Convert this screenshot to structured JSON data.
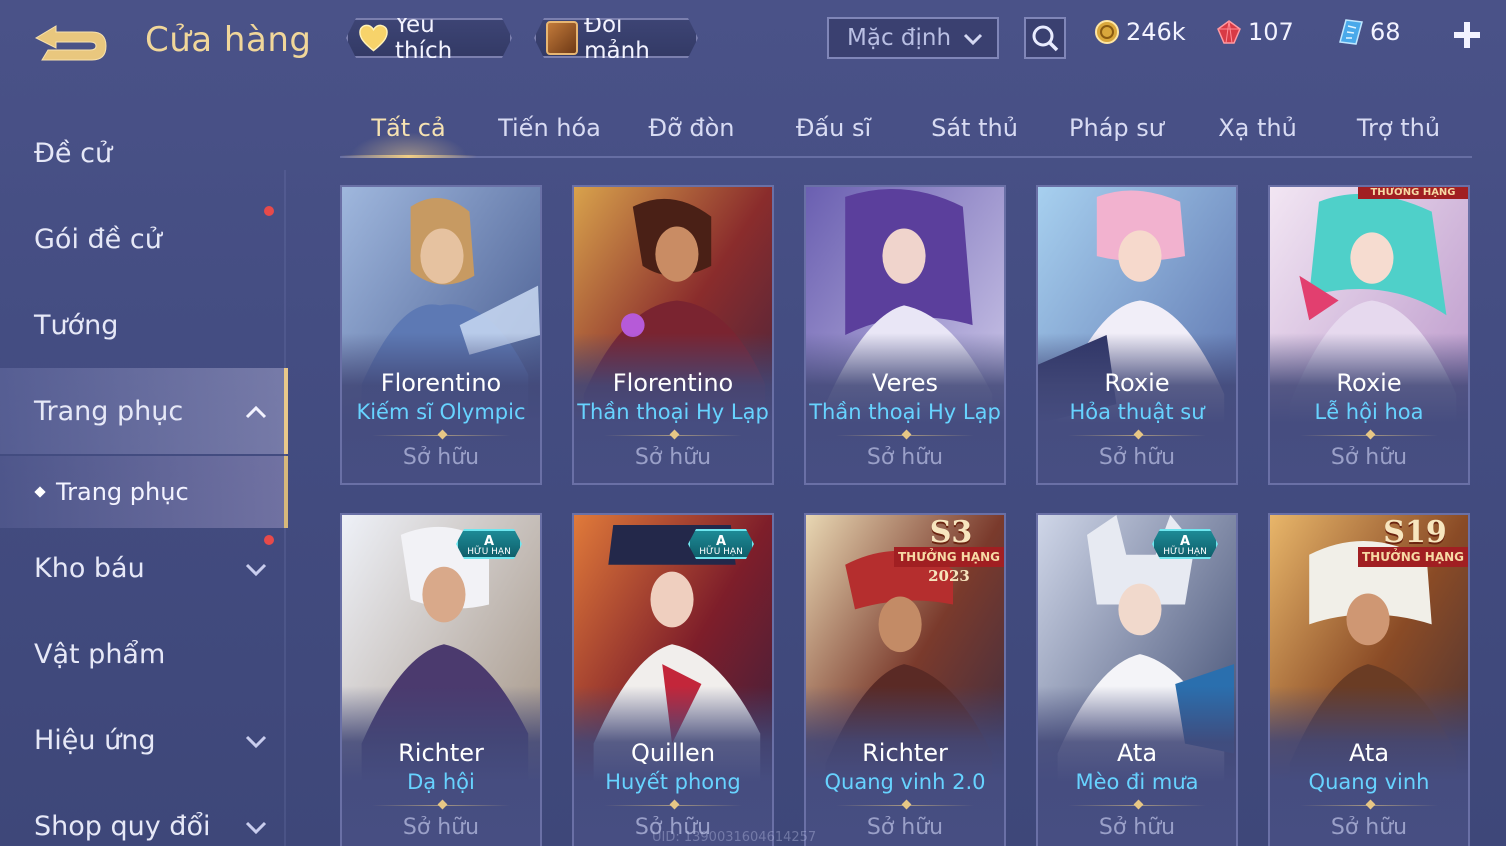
{
  "header": {
    "title": "Cửa hàng",
    "favorites_label": "Yêu thích",
    "exchange_label": "Đổi mảnh",
    "sort": {
      "selected": "Mặc định"
    }
  },
  "currencies": {
    "gold": "246k",
    "ruby": "107",
    "voucher": "68"
  },
  "sidebar": {
    "items": [
      {
        "label": "Đề cử"
      },
      {
        "label": "Gói đề cử"
      },
      {
        "label": "Tướng"
      },
      {
        "label": "Trang phục"
      },
      {
        "label": "Kho báu"
      },
      {
        "label": "Vật phẩm"
      },
      {
        "label": "Hiệu ứng"
      },
      {
        "label": "Shop quy đổi"
      }
    ],
    "sub_item": "Trang phục"
  },
  "tabs": [
    "Tất cả",
    "Tiến hóa",
    "Đỡ đòn",
    "Đấu sĩ",
    "Sát thủ",
    "Pháp sư",
    "Xạ thủ",
    "Trợ thủ"
  ],
  "cards": [
    {
      "hero": "Florentino",
      "skin": "Kiếm sĩ Olympic",
      "status": "Sở hữu"
    },
    {
      "hero": "Florentino",
      "skin": "Thần thoại Hy Lạp",
      "status": "Sở hữu"
    },
    {
      "hero": "Veres",
      "skin": "Thần thoại Hy Lạp",
      "status": "Sở hữu"
    },
    {
      "hero": "Roxie",
      "skin": "Hỏa thuật sư",
      "status": "Sở hữu"
    },
    {
      "hero": "Roxie",
      "skin": "Lễ hội hoa",
      "status": "Sở hữu",
      "badge_text": "THƯỞNG HẠNG"
    },
    {
      "hero": "Richter",
      "skin": "Dạ hội",
      "status": "Sở hữu",
      "badge_grade": "A",
      "badge_text": "HỮU HẠN"
    },
    {
      "hero": "Quillen",
      "skin": "Huyết phong",
      "status": "Sở hữu",
      "badge_grade": "A",
      "badge_text": "HỮU HẠN"
    },
    {
      "hero": "Richter",
      "skin": "Quang vinh 2.0",
      "status": "Sở hữu",
      "badge_season": "S3",
      "badge_text": "THƯỞNG HẠNG",
      "badge_year": "2023"
    },
    {
      "hero": "Ata",
      "skin": "Mèo đi mưa",
      "status": "Sở hữu",
      "badge_grade": "A",
      "badge_text": "HỮU HẠN"
    },
    {
      "hero": "Ata",
      "skin": "Quang vinh",
      "status": "Sở hữu",
      "badge_season": "S19",
      "badge_text": "THƯỞNG HẠNG"
    }
  ],
  "watermark": "UID: 1390031604614257",
  "colors": {
    "accent_gold": "#f1d79a",
    "skin_name": "#67d3ff",
    "notification": "#e74a4a"
  }
}
